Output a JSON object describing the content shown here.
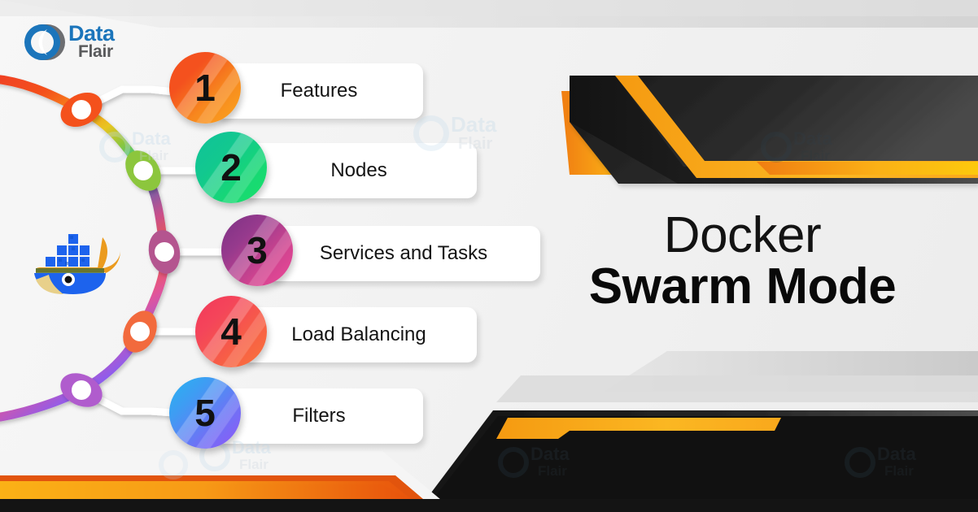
{
  "brand": {
    "logo_data": "Data",
    "logo_flair": "Flair",
    "logo_icon": "dataflair-logo-icon",
    "color_blue": "#1b75bb",
    "color_gray": "#58595b"
  },
  "title": {
    "line1": "Docker",
    "line2": "Swarm Mode"
  },
  "docker_logo": {
    "icon": "docker-whale-icon",
    "body_color": "#1d63ed",
    "tail_color": "#eb9b1e"
  },
  "steps": [
    {
      "number": "1",
      "label": "Features",
      "color_from": "#f05a28",
      "color_to": "#f9a11b",
      "node_color": "#f4511e"
    },
    {
      "number": "2",
      "label": "Nodes",
      "color_from": "#11c08a",
      "color_to": "#18dd6c",
      "node_color": "#7ac143"
    },
    {
      "number": "3",
      "label": "Services and Tasks",
      "color_from": "#8e3a8e",
      "color_to": "#e84393",
      "node_color": "#a0478f"
    },
    {
      "number": "4",
      "label": "Load Balancing",
      "color_from": "#f2385a",
      "color_to": "#f86a3d",
      "node_color": "#f26a3c"
    },
    {
      "number": "5",
      "label": "Filters",
      "color_from": "#2aa9ea",
      "color_to": "#8a5cf6",
      "node_color": "#b05ccd"
    }
  ],
  "watermarks": [
    {
      "id": "wm-1",
      "data": "Data",
      "flair": "Flair"
    },
    {
      "id": "wm-2",
      "data": "Data",
      "flair": "Flair"
    },
    {
      "id": "wm-3",
      "data": "Data",
      "flair": "Flair"
    },
    {
      "id": "wm-4",
      "data": "Data",
      "flair": "Flair"
    },
    {
      "id": "wm-5",
      "data": "Data",
      "flair": "Flair"
    },
    {
      "id": "wm-6",
      "data": "Data",
      "flair": "Flair"
    },
    {
      "id": "wm-7",
      "data": "Data",
      "flair": "Flair"
    }
  ],
  "decor": {
    "accent_orange": "#f7941e",
    "accent_yellow": "#fdc00f",
    "dark": "#1a1a1a",
    "gray_band": "#cfcfcf"
  }
}
